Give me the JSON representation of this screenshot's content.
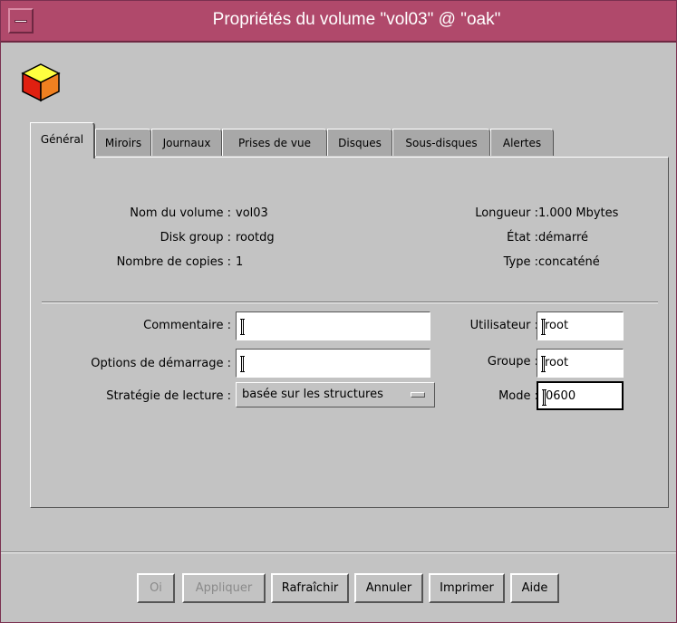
{
  "window": {
    "title": "Propriétés du volume \"vol03\" @ \"oak\""
  },
  "tabs": [
    {
      "label": "Général",
      "active": true
    },
    {
      "label": "Miroirs"
    },
    {
      "label": "Journaux"
    },
    {
      "label": "Prises de vue"
    },
    {
      "label": "Disques"
    },
    {
      "label": "Sous-disques"
    },
    {
      "label": "Alertes"
    }
  ],
  "info": {
    "volume_name_label": "Nom du volume :",
    "volume_name": "vol03",
    "disk_group_label": "Disk group :",
    "disk_group": "rootdg",
    "copies_label": "Nombre de copies :",
    "copies": "1",
    "length_label": "Longueur :",
    "length": "1.000 Mbytes",
    "state_label": "État :",
    "state": "démarré",
    "type_label": "Type :",
    "type": "concaténé"
  },
  "form": {
    "comment_label": "Commentaire :",
    "comment_value": "",
    "boot_options_label": "Options de démarrage :",
    "boot_options_value": "",
    "read_strategy_label": "Stratégie de lecture :",
    "read_strategy_value": "basée sur les structures",
    "user_label": "Utilisateur :",
    "user_value": "root",
    "group_label": "Groupe :",
    "group_value": "root",
    "mode_label": "Mode :",
    "mode_value": "0600"
  },
  "buttons": {
    "ok": "Oi",
    "apply": "Appliquer",
    "refresh": "Rafraîchir",
    "cancel": "Annuler",
    "print": "Imprimer",
    "help": "Aide"
  },
  "colors": {
    "titlebar": "#b0496b",
    "window_bg": "#c3c3c3"
  },
  "icons": {
    "window_menu": "window-menu-icon",
    "volume": "volume-cube-icon"
  }
}
